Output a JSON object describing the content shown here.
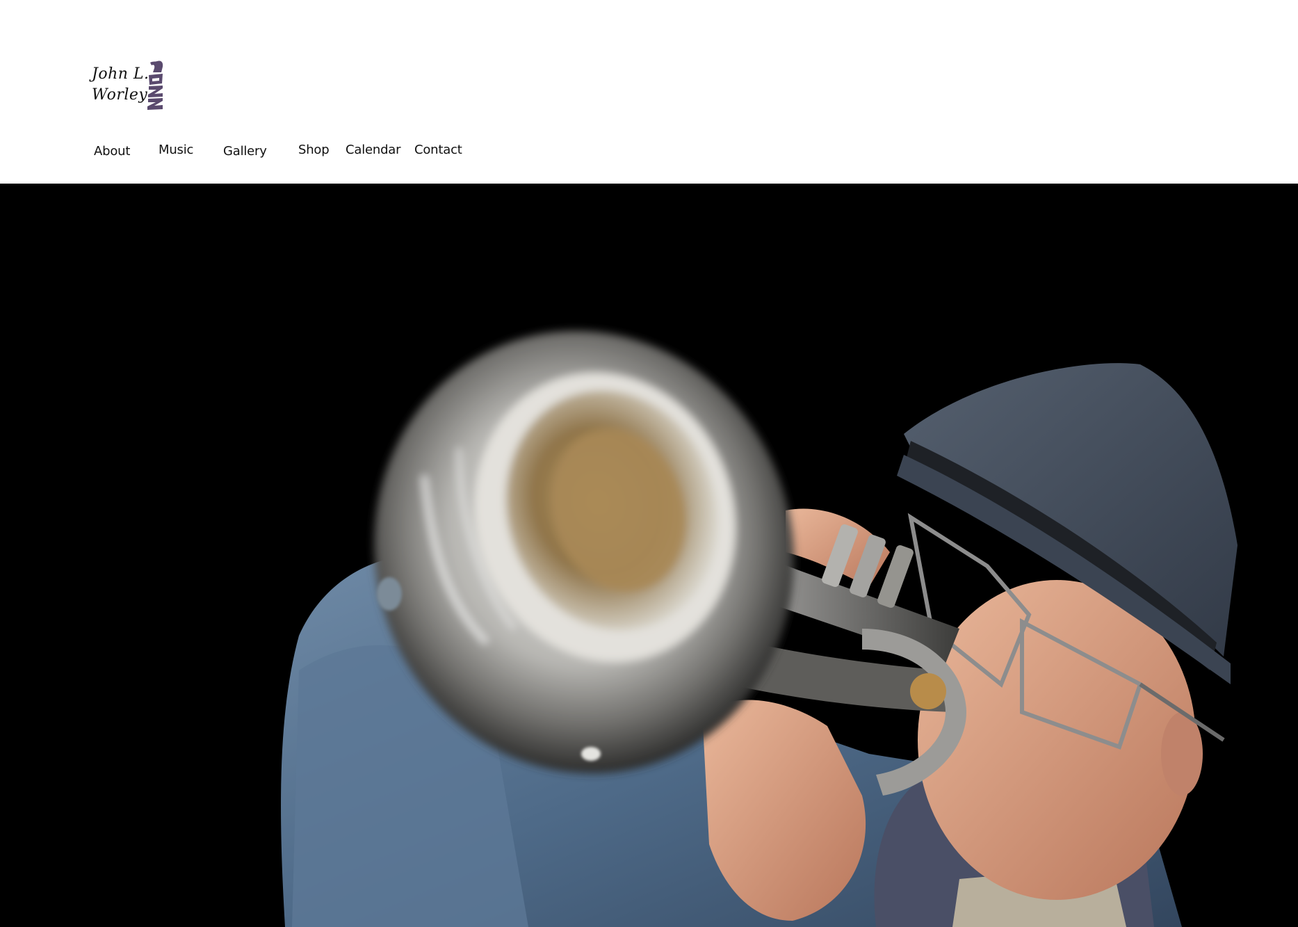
{
  "logo": {
    "line1": "John L.",
    "line2": "Worley",
    "word": "Jazz",
    "accent": "#5a4a6e"
  },
  "nav": {
    "items": [
      {
        "label": "About"
      },
      {
        "label": "Music"
      },
      {
        "label": "Gallery"
      },
      {
        "label": "Shop"
      },
      {
        "label": "Calendar"
      },
      {
        "label": "Contact"
      }
    ]
  },
  "hero": {
    "background": "#000000"
  }
}
